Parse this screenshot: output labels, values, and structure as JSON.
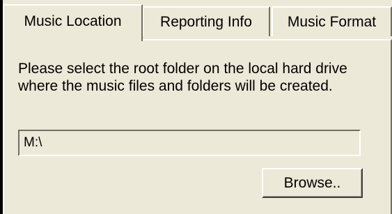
{
  "tabs": [
    {
      "label": "Music Location",
      "active": true
    },
    {
      "label": "Reporting Info",
      "active": false
    },
    {
      "label": "Music Format",
      "active": false
    }
  ],
  "music_location": {
    "instructions": "Please select the root folder on the local hard drive where the music files and folders will be created.",
    "path_value": "M:\\",
    "browse_label": "Browse.."
  },
  "colors": {
    "face": "#ece9d8",
    "shadow": "#716f64",
    "highlight": "#ffffff",
    "background": "#000000"
  }
}
